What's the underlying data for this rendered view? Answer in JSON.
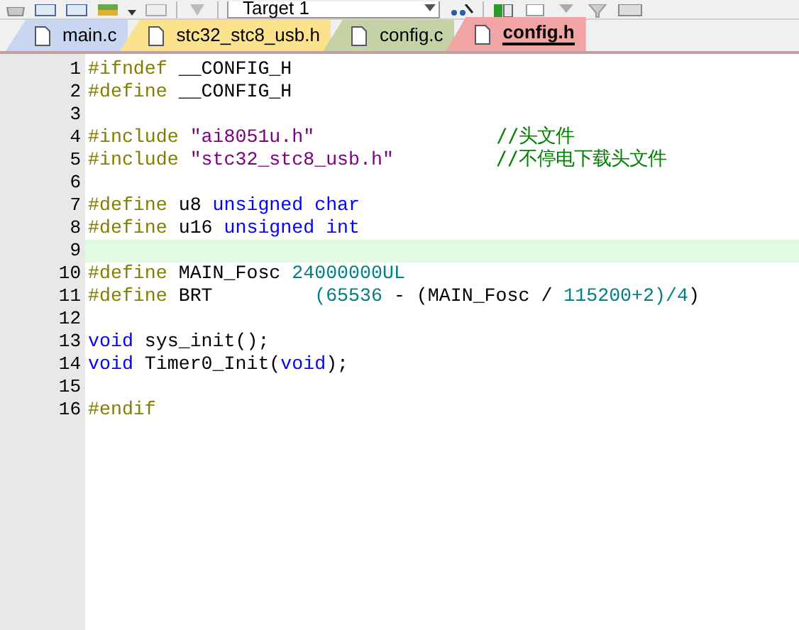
{
  "toolbar": {
    "target": "Target 1"
  },
  "tabs": [
    {
      "label": "main.c",
      "selected": false,
      "color": "#c8d6f2"
    },
    {
      "label": "stc32_stc8_usb.h",
      "selected": false,
      "color": "#fde28e"
    },
    {
      "label": "config.c",
      "selected": false,
      "color": "#c6d2a6"
    },
    {
      "label": "config.h",
      "selected": true,
      "color": "#f2a3a3"
    }
  ],
  "editor": {
    "lines": [
      {
        "number": "1",
        "current": false,
        "tokens": [
          {
            "kind": "pre",
            "text": "#ifndef"
          },
          {
            "kind": "plain",
            "text": " __CONFIG_H"
          }
        ]
      },
      {
        "number": "2",
        "current": false,
        "tokens": [
          {
            "kind": "pre",
            "text": "#define"
          },
          {
            "kind": "plain",
            "text": " __CONFIG_H"
          }
        ]
      },
      {
        "number": "3",
        "current": false
      },
      {
        "number": "4",
        "current": false,
        "tokens": [
          {
            "kind": "pre",
            "text": "#include "
          },
          {
            "kind": "string",
            "text": "\"ai8051u.h\""
          },
          {
            "kind": "comment",
            "text": "                //头文件"
          }
        ]
      },
      {
        "number": "5",
        "current": false,
        "tokens": [
          {
            "kind": "pre",
            "text": "#include "
          },
          {
            "kind": "string",
            "text": "\"stc32_stc8_usb.h\""
          },
          {
            "kind": "comment",
            "text": "         //不停电下载头文件"
          }
        ]
      },
      {
        "number": "6",
        "current": false
      },
      {
        "number": "7",
        "current": false,
        "tokens": [
          {
            "kind": "pre",
            "text": "#define"
          },
          {
            "kind": "plain",
            "text": " u8 "
          },
          {
            "kind": "keyword",
            "text": "unsigned char"
          }
        ]
      },
      {
        "number": "8",
        "current": false,
        "tokens": [
          {
            "kind": "pre",
            "text": "#define"
          },
          {
            "kind": "plain",
            "text": " u16 "
          },
          {
            "kind": "keyword",
            "text": "unsigned int"
          }
        ]
      },
      {
        "number": "9",
        "current": true
      },
      {
        "number": "10",
        "current": false,
        "tokens": [
          {
            "kind": "pre",
            "text": "#define"
          },
          {
            "kind": "plain",
            "text": " MAIN_Fosc "
          },
          {
            "kind": "number",
            "text": "24000000UL"
          }
        ]
      },
      {
        "number": "11",
        "current": false,
        "tokens": [
          {
            "kind": "pre",
            "text": "#define"
          },
          {
            "kind": "plain",
            "text": " BRT         "
          },
          {
            "kind": "number",
            "text": "(65536"
          },
          {
            "kind": "plain",
            "text": " - (MAIN_Fosc / "
          },
          {
            "kind": "number",
            "text": "115200+2)/4"
          },
          {
            "kind": "plain",
            "text": ")"
          }
        ]
      },
      {
        "number": "12",
        "current": false
      },
      {
        "number": "13",
        "current": false,
        "tokens": [
          {
            "kind": "keyword",
            "text": "void"
          },
          {
            "kind": "plain",
            "text": " sys_init();"
          }
        ]
      },
      {
        "number": "14",
        "current": false,
        "tokens": [
          {
            "kind": "keyword",
            "text": "void"
          },
          {
            "kind": "plain",
            "text": " Timer0_Init("
          },
          {
            "kind": "keyword",
            "text": "void"
          },
          {
            "kind": "plain",
            "text": ");"
          }
        ]
      },
      {
        "number": "15",
        "current": false
      },
      {
        "number": "16",
        "current": false,
        "tokens": [
          {
            "kind": "pre",
            "text": "#endif"
          }
        ]
      }
    ]
  }
}
